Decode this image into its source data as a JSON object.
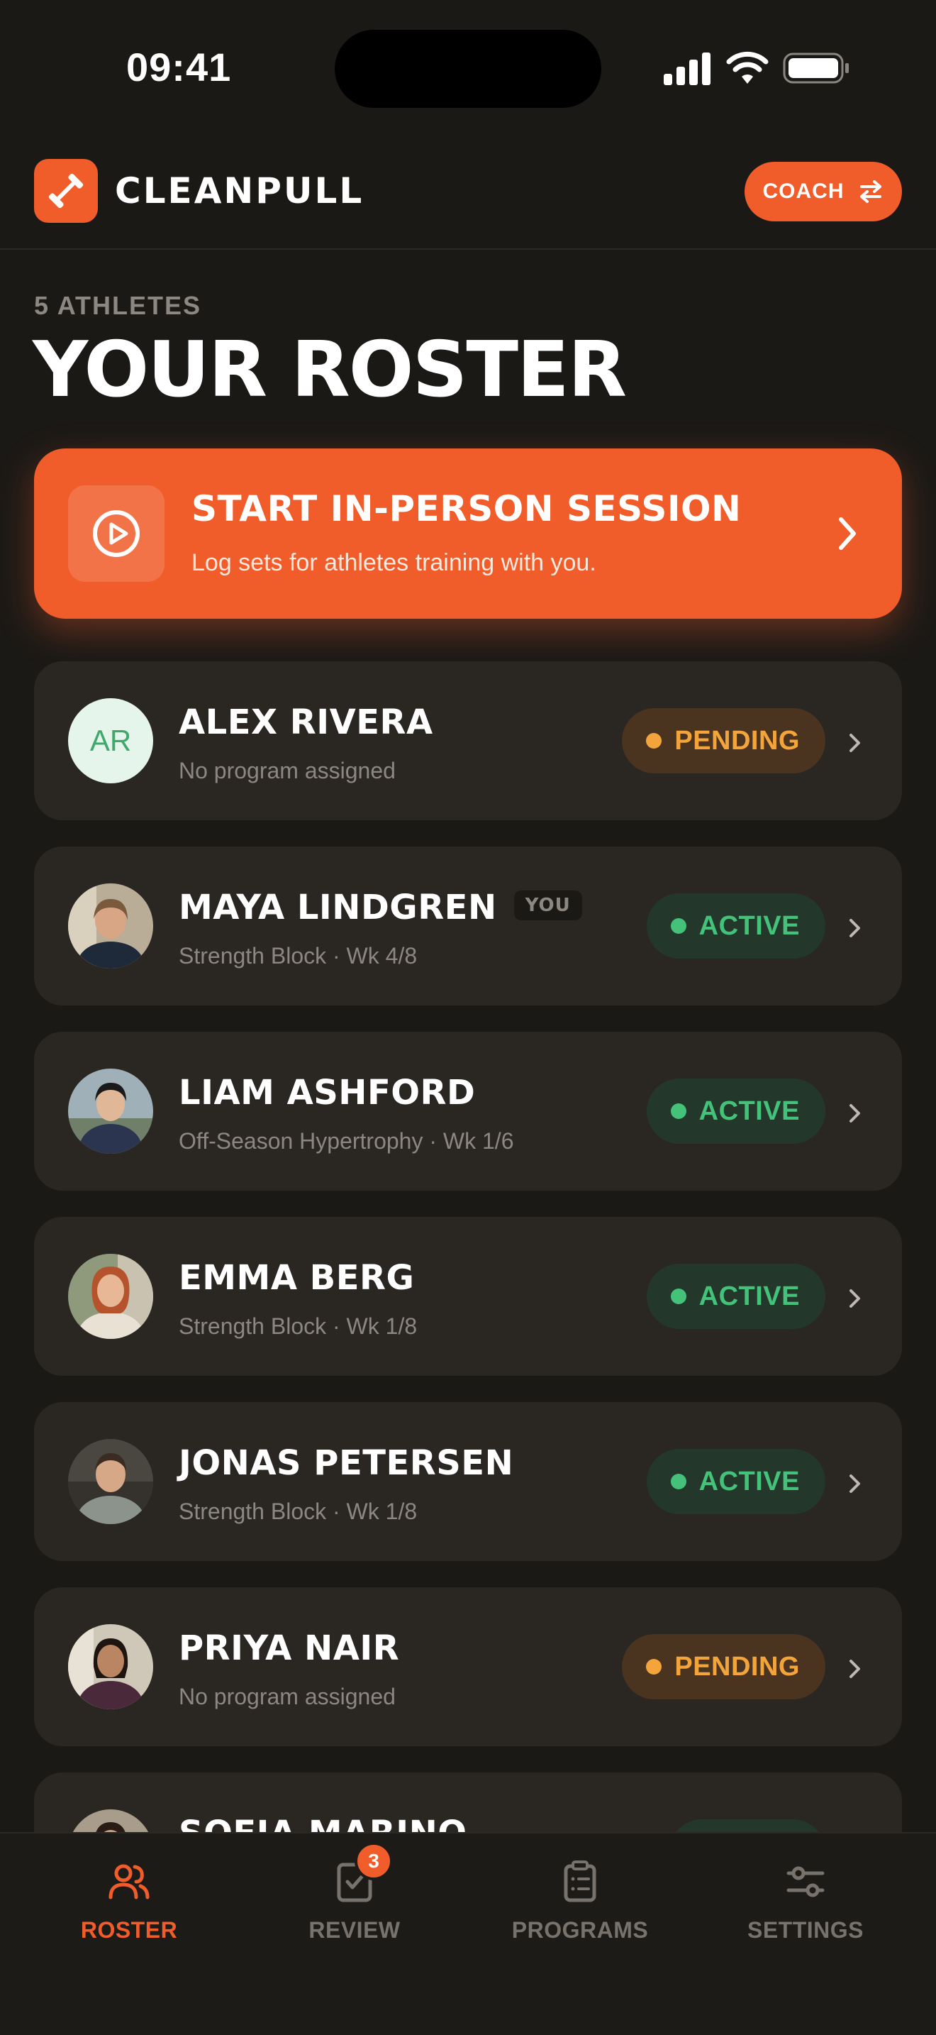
{
  "status_bar": {
    "time": "09:41"
  },
  "header": {
    "brand": "CLEANPULL",
    "coach_label": "COACH"
  },
  "roster": {
    "eyebrow": "5 ATHLETES",
    "title": "YOUR ROSTER"
  },
  "session_card": {
    "title": "START IN-PERSON SESSION",
    "subtitle": "Log sets for athletes training with you."
  },
  "athletes": [
    {
      "name": "ALEX RIVERA",
      "initials": "AR",
      "badge": "",
      "subtitle": "No program assigned",
      "status": "PENDING",
      "status_type": "pending"
    },
    {
      "name": "MAYA LINDGREN",
      "initials": "",
      "badge": "YOU",
      "subtitle": "Strength Block · Wk 4/8",
      "status": "ACTIVE",
      "status_type": "active"
    },
    {
      "name": "LIAM ASHFORD",
      "initials": "",
      "badge": "",
      "subtitle": "Off-Season Hypertrophy · Wk 1/6",
      "status": "ACTIVE",
      "status_type": "active"
    },
    {
      "name": "EMMA BERG",
      "initials": "",
      "badge": "",
      "subtitle": "Strength Block · Wk 1/8",
      "status": "ACTIVE",
      "status_type": "active"
    },
    {
      "name": "JONAS PETERSEN",
      "initials": "",
      "badge": "",
      "subtitle": "Strength Block · Wk 1/8",
      "status": "ACTIVE",
      "status_type": "active"
    },
    {
      "name": "PRIYA NAIR",
      "initials": "",
      "badge": "",
      "subtitle": "No program assigned",
      "status": "PENDING",
      "status_type": "pending"
    },
    {
      "name": "SOFIA MARINO",
      "initials": "",
      "badge": "",
      "subtitle": "",
      "status": "",
      "status_type": "active"
    }
  ],
  "bottom_nav": {
    "items": [
      {
        "label": "ROSTER",
        "icon": "users-icon",
        "active": true
      },
      {
        "label": "REVIEW",
        "icon": "clipboard-check-icon",
        "badge": "3"
      },
      {
        "label": "PROGRAMS",
        "icon": "clipboard-list-icon"
      },
      {
        "label": "SETTINGS",
        "icon": "sliders-icon"
      }
    ]
  },
  "colors": {
    "accent": "#f05d2a",
    "background": "#1b1916",
    "card": "#2a2723",
    "active": "#45c27a",
    "pending": "#f3a53c"
  }
}
